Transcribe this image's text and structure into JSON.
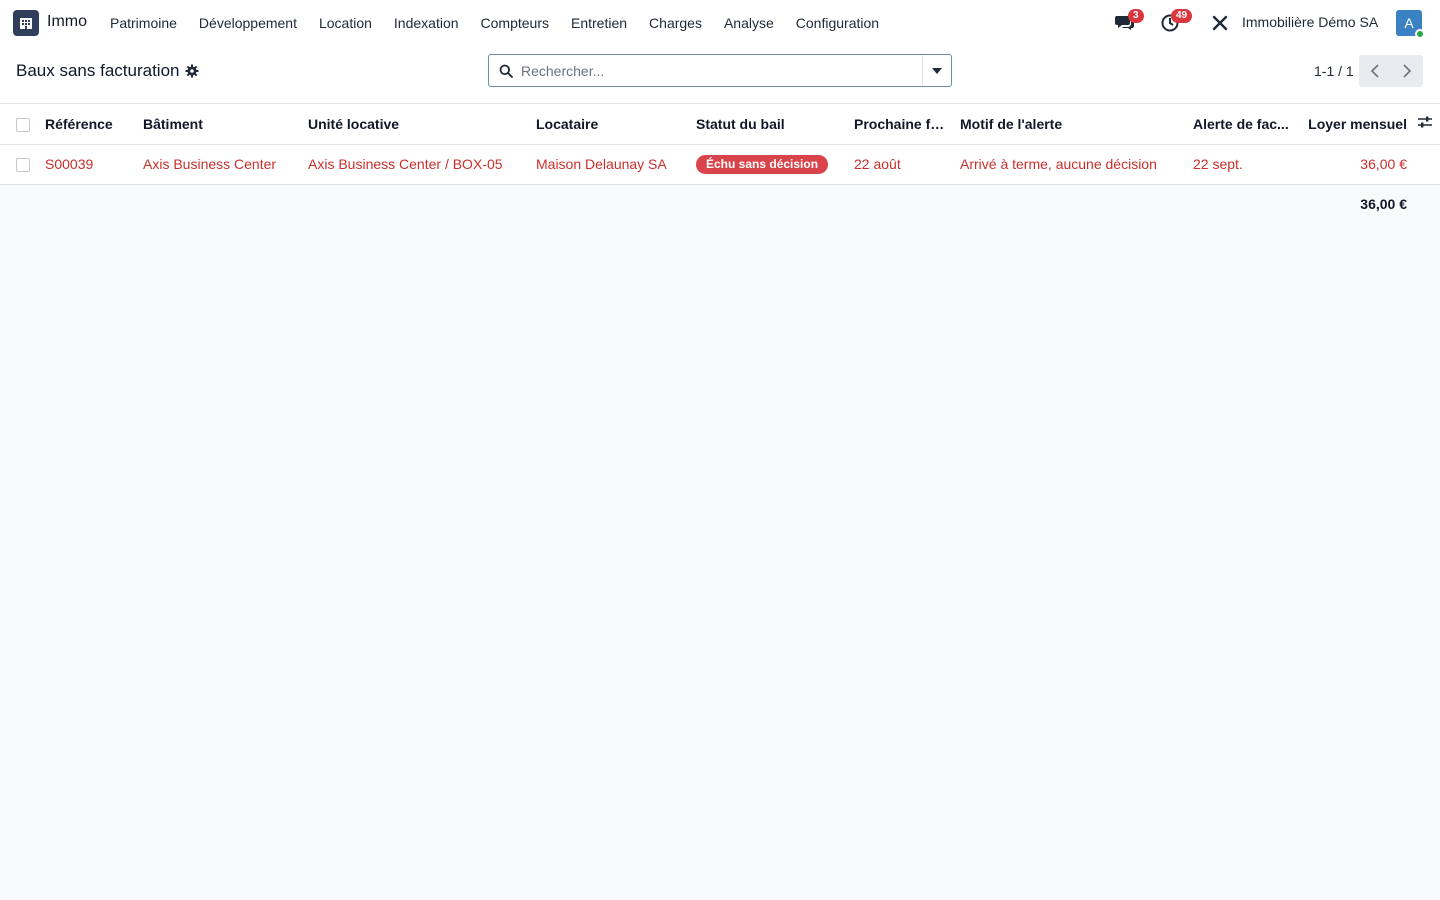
{
  "app": {
    "name": "Immo"
  },
  "menu": [
    {
      "label": "Patrimoine"
    },
    {
      "label": "Développement"
    },
    {
      "label": "Location"
    },
    {
      "label": "Indexation"
    },
    {
      "label": "Compteurs"
    },
    {
      "label": "Entretien"
    },
    {
      "label": "Charges"
    },
    {
      "label": "Analyse"
    },
    {
      "label": "Configuration"
    }
  ],
  "systray": {
    "messages_count": "3",
    "activities_count": "49",
    "company": "Immobilière Démo SA",
    "avatar_letter": "A"
  },
  "control_panel": {
    "title": "Baux sans facturation",
    "search_placeholder": "Rechercher...",
    "pager": "1-1 / 1"
  },
  "table": {
    "columns": {
      "reference": "Référence",
      "building": "Bâtiment",
      "unit": "Unité locative",
      "tenant": "Locataire",
      "status": "Statut du bail",
      "next_invoice": "Prochaine fa...",
      "reason": "Motif de l'alerte",
      "alert": "Alerte de fac...",
      "rent": "Loyer mensuel"
    },
    "rows": [
      {
        "reference": "S00039",
        "building": "Axis Business Center",
        "unit": "Axis Business Center / BOX-05",
        "tenant": "Maison Delaunay SA",
        "status": "Échu sans décision",
        "next_invoice": "22 août",
        "reason": "Arrivé à terme, aucune décision",
        "alert": "22 sept.",
        "rent": "36,00 €"
      }
    ],
    "total_rent": "36,00 €"
  },
  "colors": {
    "danger_text": "#c9302c",
    "status_badge": "#d9434a",
    "logo_bg": "#2f3e5b"
  }
}
